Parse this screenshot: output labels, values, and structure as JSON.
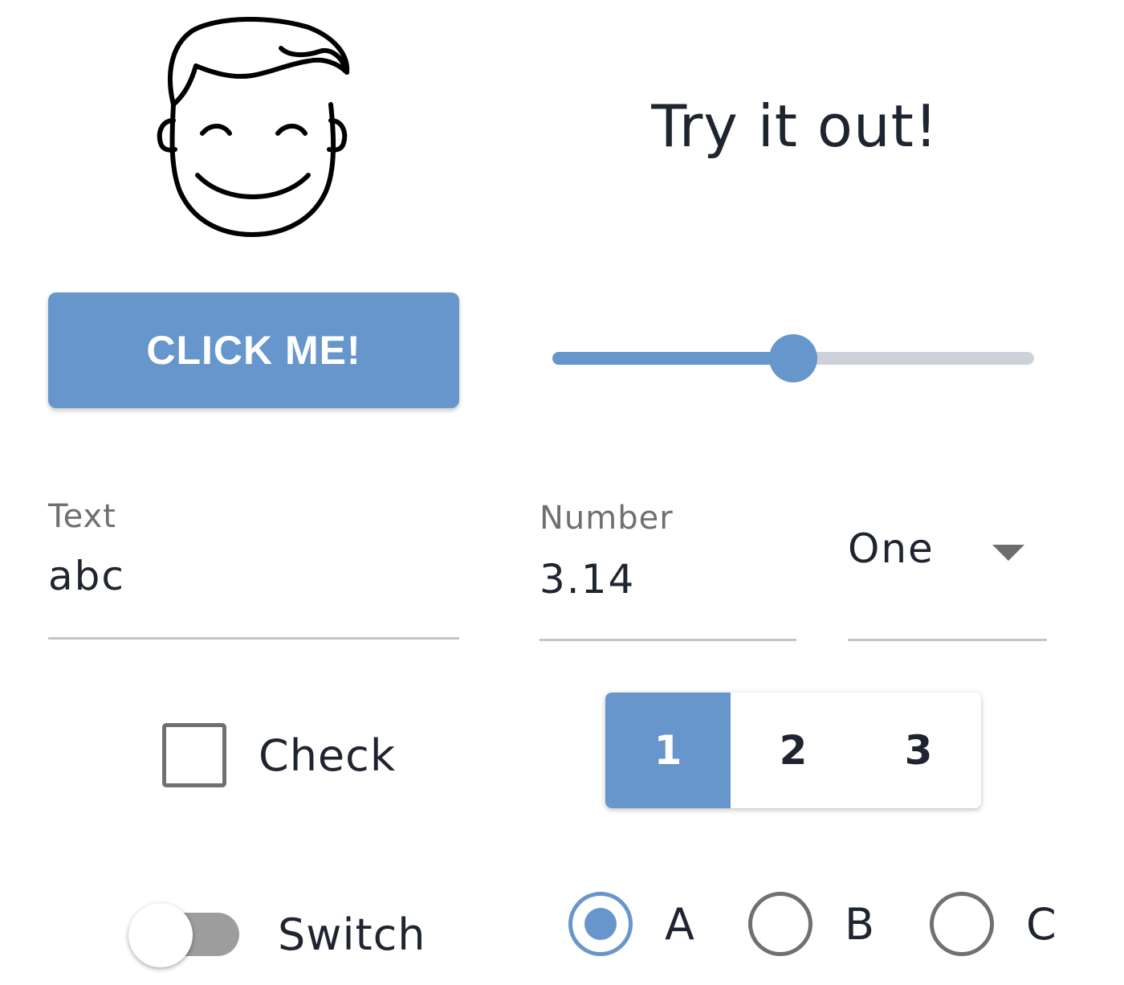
{
  "header": {
    "title": "Try it out!",
    "illustration_icon": "smiling-face-icon"
  },
  "button": {
    "label": "CLICK ME!"
  },
  "slider": {
    "value": 0.5
  },
  "text_field": {
    "label": "Text",
    "value": "abc"
  },
  "number_field": {
    "label": "Number",
    "value": "3.14"
  },
  "select": {
    "value": "One",
    "icon": "chevron-down-icon"
  },
  "checkbox": {
    "label": "Check",
    "checked": false
  },
  "toggle_group": {
    "buttons": [
      {
        "label": "1",
        "active": true
      },
      {
        "label": "2",
        "active": false
      },
      {
        "label": "3",
        "active": false
      }
    ]
  },
  "switch": {
    "label": "Switch",
    "on": false
  },
  "radio_group": {
    "options": [
      {
        "label": "A",
        "checked": true
      },
      {
        "label": "B",
        "checked": false
      },
      {
        "label": "C",
        "checked": false
      }
    ]
  },
  "colors": {
    "accent": "#6796cd",
    "text": "#1f2530",
    "muted": "#6f6f6f",
    "border": "#707070"
  }
}
